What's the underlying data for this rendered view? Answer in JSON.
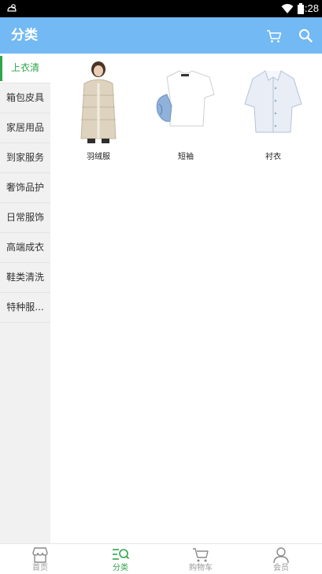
{
  "status_bar": {
    "time": "3:28",
    "icons": [
      "notification-icon",
      "wifi-icon",
      "battery-icon"
    ]
  },
  "header": {
    "title": "分类",
    "cart_icon": "cart-icon",
    "search_icon": "search-icon"
  },
  "sidebar": {
    "items": [
      {
        "label": "上衣清",
        "active": true
      },
      {
        "label": "箱包皮具"
      },
      {
        "label": "家居用品"
      },
      {
        "label": "到家服务"
      },
      {
        "label": "奢饰品护"
      },
      {
        "label": "日常服饰"
      },
      {
        "label": "高端成衣"
      },
      {
        "label": "鞋类清洗"
      },
      {
        "label": "特种服..."
      }
    ]
  },
  "products": [
    {
      "label": "羽绒服",
      "image": "down-jacket-image"
    },
    {
      "label": "短袖",
      "image": "short-sleeve-tshirt-image"
    },
    {
      "label": "衬衣",
      "image": "shirt-image"
    }
  ],
  "tabbar": {
    "tabs": [
      {
        "label": "首页",
        "icon": "store-icon"
      },
      {
        "label": "分类",
        "icon": "category-icon",
        "active": true
      },
      {
        "label": "购物车",
        "icon": "cart-icon"
      },
      {
        "label": "会员",
        "icon": "member-icon"
      }
    ]
  },
  "colors": {
    "primary": "#73b9f3",
    "accent_green": "#2fa54a",
    "sidebar_bg": "#f1f1f1"
  }
}
